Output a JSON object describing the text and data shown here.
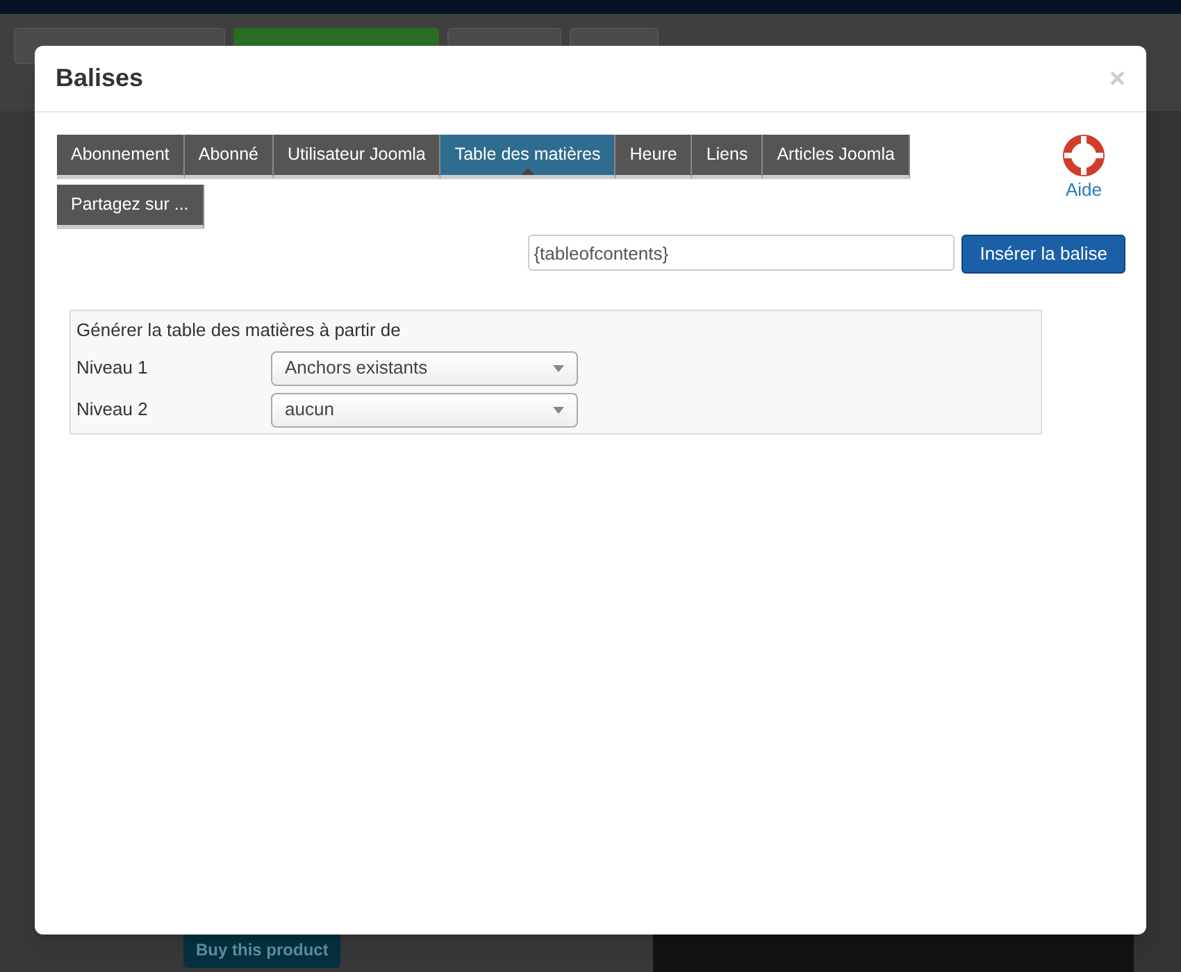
{
  "background_page": {
    "buy_button": "Buy this product"
  },
  "dialog": {
    "title": "Balises",
    "close": "×",
    "tabs": [
      {
        "label": "Abonnement",
        "selected": false
      },
      {
        "label": "Abonné",
        "selected": false
      },
      {
        "label": "Utilisateur Joomla",
        "selected": false
      },
      {
        "label": "Table des matières",
        "selected": true
      },
      {
        "label": "Heure",
        "selected": false
      },
      {
        "label": "Liens",
        "selected": false
      },
      {
        "label": "Articles Joomla",
        "selected": false
      },
      {
        "label": "Partagez sur ...",
        "selected": false
      }
    ],
    "help_link": "Aide",
    "tag_field": {
      "value": "{tableofcontents}"
    },
    "insert_button": "Insérer la balise",
    "panel": {
      "heading": "Générer la table des matières à partir de",
      "rows": [
        {
          "label": "Niveau 1",
          "value": "Anchors existants"
        },
        {
          "label": "Niveau 2",
          "value": "aucun"
        }
      ]
    }
  }
}
